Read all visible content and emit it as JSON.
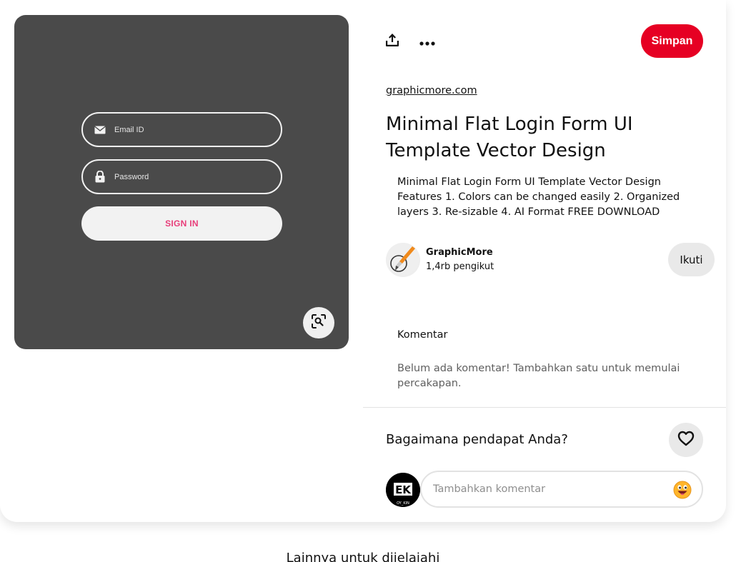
{
  "image": {
    "email_placeholder": "Email ID",
    "password_placeholder": "Password",
    "signin_label": "SIGN IN",
    "signin_color": "#e83e7a",
    "background_color": "#4a4a4a"
  },
  "actions": {
    "save_label": "Simpan",
    "save_color": "#e60023"
  },
  "pin": {
    "source": "graphicmore.com",
    "title": "Minimal Flat Login Form UI Template Vector Design",
    "description": "Minimal Flat Login Form UI Template Vector Design Features 1. Colors can be changed easily 2. Organized layers 3. Re-sizable 4. AI Format FREE DOWNLOAD"
  },
  "creator": {
    "name": "GraphicMore",
    "followers": "1,4rb pengikut",
    "follow_label": "Ikuti",
    "avatar_icon": "paintbrush-icon"
  },
  "comments": {
    "heading": "Komentar",
    "empty_text": "Belum ada komentar! Tambahkan satu untuk memulai percakapan."
  },
  "feedback": {
    "question": "Bagaimana pendapat Anda?"
  },
  "comment_input": {
    "placeholder": "Tambahkan komentar",
    "avatar_text": "EK",
    "avatar_subtext": "OY_KIN"
  },
  "explore": {
    "heading": "Lainnya untuk dijelajahi"
  }
}
